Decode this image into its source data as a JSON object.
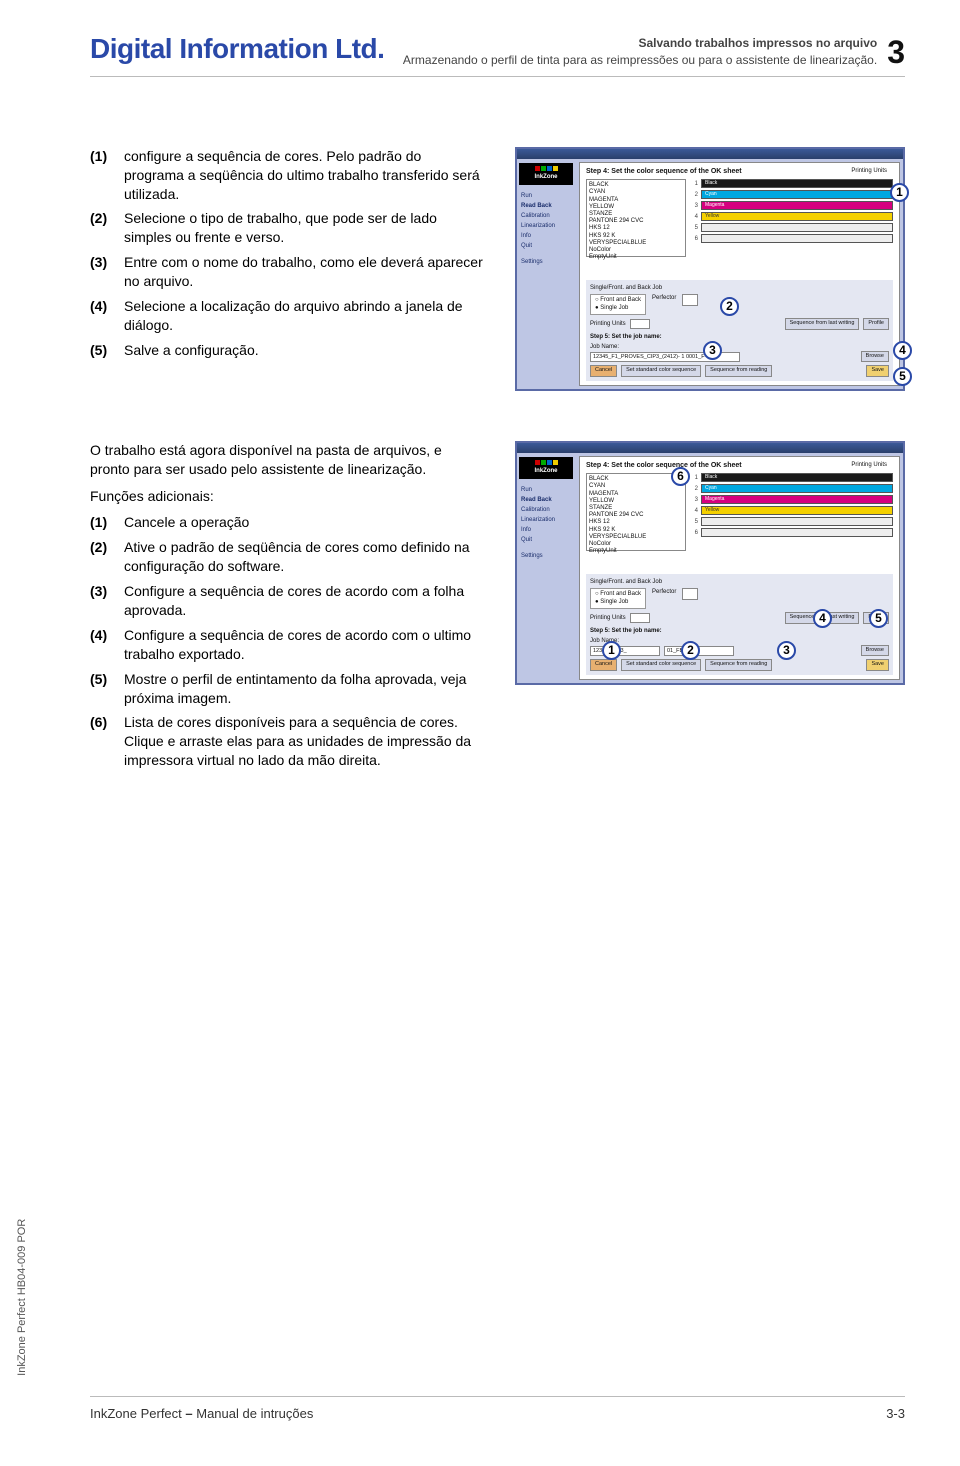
{
  "header": {
    "logo": "Digital Information Ltd.",
    "title": "Salvando trabalhos impressos no arquivo",
    "subtitle": "Armazenando o perfil de tinta para as reimpressões ou para o assistente de linearização.",
    "chapter": "3"
  },
  "section1": {
    "items": [
      {
        "n": "(1)",
        "text": "configure a sequência de cores. Pelo padrão do programa a seqüência do ultimo trabalho transferido será utilizada."
      },
      {
        "n": "(2)",
        "text": "Selecione o tipo de trabalho, que pode ser de lado simples ou frente e verso."
      },
      {
        "n": "(3)",
        "text": "Entre com o nome do trabalho, como ele deverá aparecer no arquivo."
      },
      {
        "n": "(4)",
        "text": "Selecione a localização do arquivo abrindo a janela de diálogo."
      },
      {
        "n": "(5)",
        "text": "Salve a configuração."
      }
    ]
  },
  "section2": {
    "intro": "O trabalho está agora disponível na pasta de arquivos, e pronto para ser usado pelo assistente de linearização.",
    "funcs_label": "Funções adicionais:",
    "items": [
      {
        "n": "(1)",
        "text": "Cancele a operação"
      },
      {
        "n": "(2)",
        "text": "Ative o padrão de seqüência de cores como definido na configuração do software."
      },
      {
        "n": "(3)",
        "text": "Configure a sequência de cores de acordo com a folha aprovada."
      },
      {
        "n": "(4)",
        "text": "Configure a sequência de cores de acordo com o ultimo trabalho exportado."
      },
      {
        "n": "(5)",
        "text": "Mostre o perfil de entintamento da folha aprovada, veja próxima imagem."
      },
      {
        "n": "(6)",
        "text": "Lista de cores disponíveis para a sequência de cores. Clique e arraste elas para as unidades de impressão da impressora virtual no lado da mão direita."
      }
    ]
  },
  "mock": {
    "izlogo": "InkZone",
    "side_items": [
      "Run",
      "Read Back",
      "Calibration",
      "Linearization",
      "Info",
      "Quit",
      "",
      "Settings"
    ],
    "step4": "Step 4: Set the color sequence of the OK sheet",
    "printing_units": "Printing Units",
    "colors": [
      "BLACK",
      "CYAN",
      "MAGENTA",
      "YELLOW",
      "STANZE",
      "PANTONE 294 CVC",
      "HKS 12",
      "HKS 92 K",
      "VERYSPECIALBLUE",
      "NoColor",
      "EmptyUnit"
    ],
    "units": [
      {
        "num": "1",
        "name": "Black",
        "bg": "#1a1a1a"
      },
      {
        "num": "2",
        "name": "Cyan",
        "bg": "#00a8e0"
      },
      {
        "num": "3",
        "name": "Magenta",
        "bg": "#d6007f"
      },
      {
        "num": "4",
        "name": "Yellow",
        "bg": "#f4d000",
        "fg": "#333"
      },
      {
        "num": "5",
        "name": "",
        "bg": "#eee"
      },
      {
        "num": "6",
        "name": "",
        "bg": "#eee"
      }
    ],
    "fb_head": "Single/Front. and Back Job",
    "fb_opt1": "Front and Back",
    "fb_opt2": "Single Job",
    "perfector": "Perfector",
    "pu_line": "Printing Units",
    "btn_seq_last": "Sequence from last writing",
    "btn_profile": "Profile",
    "step5": "Step 5: Set the job name:",
    "jobname_label": "Job Name:",
    "jobname_value": "12345_F1_PROVES_CIP3_(2412)- 1 0001_F",
    "jobname_value2_left": "12345_CIP3_",
    "jobname_value2_right": "01_FB",
    "btn_browse": "Browse",
    "btn_cancel": "Cancel",
    "btn_setstd": "Set standard color sequence",
    "btn_seqread": "Sequence from reading",
    "btn_save": "Save"
  },
  "callouts1": [
    "1",
    "2",
    "3",
    "4",
    "5"
  ],
  "callouts2": [
    "1",
    "2",
    "3",
    "4",
    "5",
    "6"
  ],
  "side_text": "InkZone Perfect HB04-009 POR",
  "footer": {
    "product": "InkZone Perfect",
    "sep": " – ",
    "doc": "Manual de intruções",
    "page": "3-3"
  }
}
